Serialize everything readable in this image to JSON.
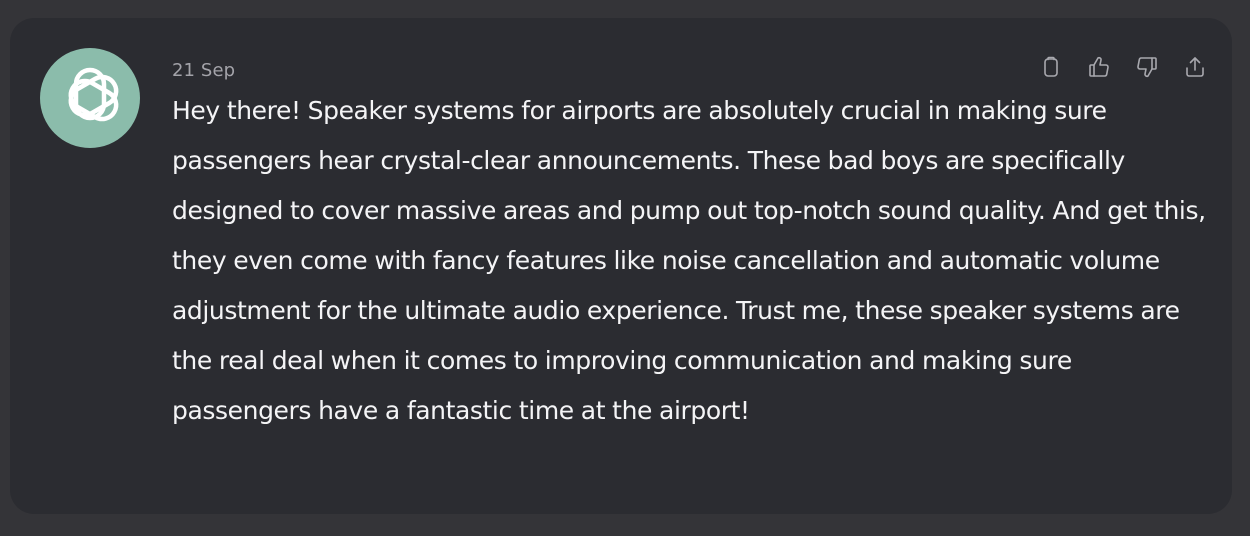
{
  "colors": {
    "page_bg": "#343438",
    "card_bg": "#2b2c31",
    "avatar_bg": "#8bbcab",
    "text": "#f4f4f6",
    "muted": "#a3a3a9",
    "icon": "#a8a8ae"
  },
  "message": {
    "avatar_icon": "openai-logo-icon",
    "timestamp": "21 Sep",
    "text": "Hey there! Speaker systems for airports are absolutely crucial in making sure passengers hear crystal-clear announcements. These bad boys are specifically designed to cover massive areas and pump out top-notch sound quality. And get this, they even come with fancy features like noise cancellation and automatic volume adjustment for the ultimate audio experience. Trust me, these speaker systems are the real deal when it comes to improving communication and making sure passengers have a fantastic time at the airport!"
  },
  "actions": [
    {
      "icon": "clipboard-icon"
    },
    {
      "icon": "thumbs-up-icon"
    },
    {
      "icon": "thumbs-down-icon"
    },
    {
      "icon": "share-icon"
    }
  ]
}
